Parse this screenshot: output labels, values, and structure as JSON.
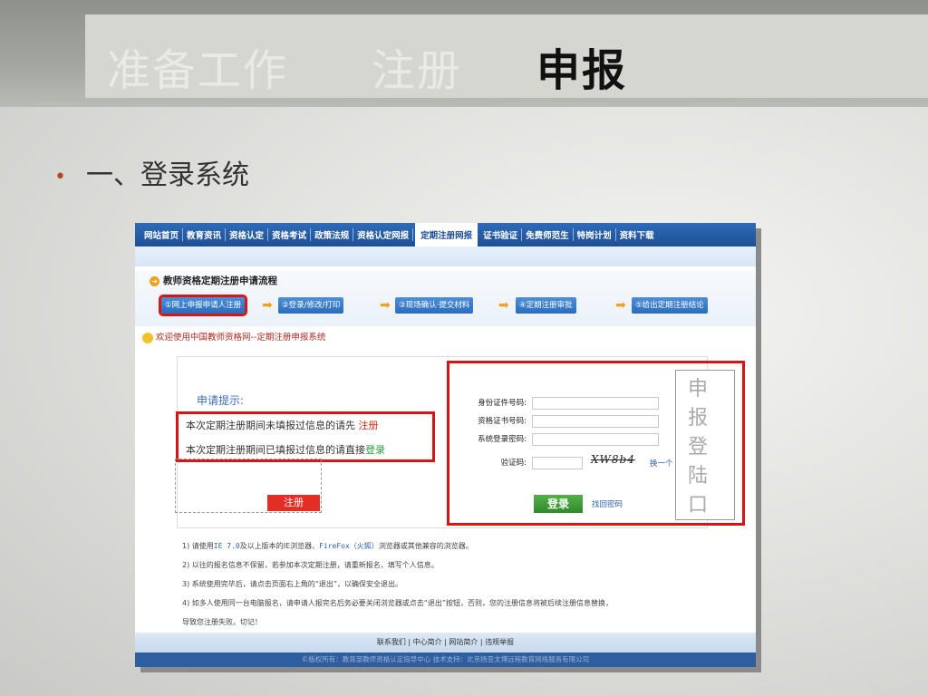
{
  "slide": {
    "tabs": [
      {
        "label": "准备工作",
        "active": false
      },
      {
        "label": "注册",
        "active": false
      },
      {
        "label": "申报",
        "active": true
      }
    ],
    "bullet": "一、登录系统"
  },
  "site": {
    "nav": [
      "网站首页",
      "教育资讯",
      "资格认定",
      "资格考试",
      "政策法规",
      "资格认定网报",
      "定期注册网报",
      "证书验证",
      "免费师范生",
      "特岗计划",
      "资料下载"
    ],
    "nav_active_index": 6,
    "process_title": "教师资格定期注册申请流程",
    "steps": [
      "①网上申报申请人注册",
      "②登录/修改/打印",
      "③现场确认·提交材料",
      "④定期注册审批",
      "⑤给出定期注册结论"
    ],
    "welcome": "欢迎使用中国教师资格网--定期注册申报系统",
    "tips_title": "申请提示:",
    "tip1_prefix": "本次定期注册期间未填报过信息的请先",
    "tip1_link": "注册",
    "tip2_prefix": "本次定期注册期间已填报过信息的请直接",
    "tip2_link": "登录",
    "register_button": "注册",
    "form": {
      "id_label": "身份证件号码:",
      "cert_label": "资格证书号码:",
      "password_label": "系统登录密码:",
      "captcha_label": "验证码:",
      "captcha_text": "XW8b4",
      "swap_label": "换一个",
      "login_button": "登录",
      "forgot_link": "找回密码"
    },
    "side_vertical": "申报登陆口",
    "notes": [
      {
        "pre": "1) 请使用",
        "hl1": "IE 7.0",
        "mid": "及以上版本的IE浏览器、",
        "hl2": "FireFox（火狐）",
        "post": "浏览器或其他兼容的浏览器。"
      },
      {
        "pre": "2) 以往的报名信息不保留，若参加本次定期注册，请重新报名，填写个人信息。",
        "hl1": "",
        "mid": "",
        "hl2": "",
        "post": ""
      },
      {
        "pre": "3) 系统使用完毕后，请点击页面右上角的“退出”，以确保安全退出。",
        "hl1": "",
        "mid": "",
        "hl2": "",
        "post": ""
      },
      {
        "pre": "4) 如多人使用同一台电脑报名，请申请人报完名后务必要关闭浏览器或点击“退出”按钮，否则，您的注册信息将被后续注册信息替换，",
        "hl1": "",
        "mid": "",
        "hl2": "",
        "post": ""
      },
      {
        "pre": "导致您注册失败。切记！",
        "hl1": "",
        "mid": "",
        "hl2": "",
        "post": ""
      }
    ],
    "footer_links": "联系我们 | 中心简介 | 网站简介 | 违规举报",
    "footer_copyright": "©版权所有：教育部教师资格认定指导中心 技术支持：北京扬亚太博远程教育网络服务有限公司"
  }
}
